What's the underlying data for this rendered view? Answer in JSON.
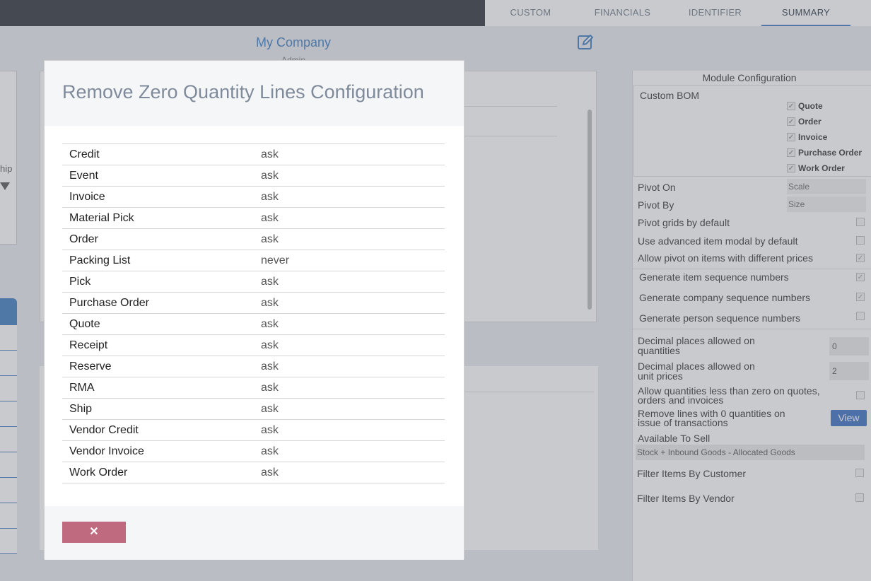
{
  "tabs": [
    "CUSTOM",
    "FINANCIALS",
    "IDENTIFIER",
    "SUMMARY"
  ],
  "company": {
    "name": "My Company",
    "subtitle": "Admin"
  },
  "left_panel": {
    "truncated_text": "hip"
  },
  "right_panel": {
    "title": "Module Configuration",
    "custom_bom": {
      "label": "Custom BOM",
      "items": [
        "Quote",
        "Order",
        "Invoice",
        "Purchase Order",
        "Work Order"
      ]
    },
    "pivot_on": {
      "label": "Pivot On",
      "value": "Scale"
    },
    "pivot_by": {
      "label": "Pivot By",
      "value": "Size"
    },
    "pivot_grids_default": "Pivot grids by default",
    "advanced_item_modal": "Use advanced item modal by default",
    "allow_pivot_diff_prices": "Allow pivot on items with different prices",
    "gen_item_seq": "Generate item sequence numbers",
    "gen_company_seq": "Generate company sequence numbers",
    "gen_person_seq": "Generate person sequence numbers",
    "decimal_qty": {
      "label1": "Decimal places allowed on",
      "label2": "quantities",
      "value": "0"
    },
    "decimal_price": {
      "label1": "Decimal places allowed on",
      "label2": "unit prices",
      "value": "2"
    },
    "allow_neg_qty": {
      "label1": "Allow quantities less than zero on quotes,",
      "label2": "orders and invoices"
    },
    "remove_zero_lines": {
      "label1": "Remove lines with 0 quantities on",
      "label2": "issue of transactions",
      "button": "View"
    },
    "available_to_sell": {
      "label": "Available To Sell",
      "value": "Stock + Inbound Goods - Allocated Goods"
    },
    "filter_by_customer": "Filter Items By Customer",
    "filter_by_vendor": "Filter Items By Vendor"
  },
  "modal": {
    "title": "Remove Zero Quantity Lines Configuration",
    "rows": [
      {
        "name": "Credit",
        "value": "ask"
      },
      {
        "name": "Event",
        "value": "ask"
      },
      {
        "name": "Invoice",
        "value": "ask"
      },
      {
        "name": "Material Pick",
        "value": "ask"
      },
      {
        "name": "Order",
        "value": "ask"
      },
      {
        "name": "Packing List",
        "value": "never"
      },
      {
        "name": "Pick",
        "value": "ask"
      },
      {
        "name": "Purchase Order",
        "value": "ask"
      },
      {
        "name": "Quote",
        "value": "ask"
      },
      {
        "name": "Receipt",
        "value": "ask"
      },
      {
        "name": "Reserve",
        "value": "ask"
      },
      {
        "name": "RMA",
        "value": "ask"
      },
      {
        "name": "Ship",
        "value": "ask"
      },
      {
        "name": "Vendor Credit",
        "value": "ask"
      },
      {
        "name": "Vendor Invoice",
        "value": "ask"
      },
      {
        "name": "Work Order",
        "value": "ask"
      }
    ],
    "close_label": "✕"
  }
}
